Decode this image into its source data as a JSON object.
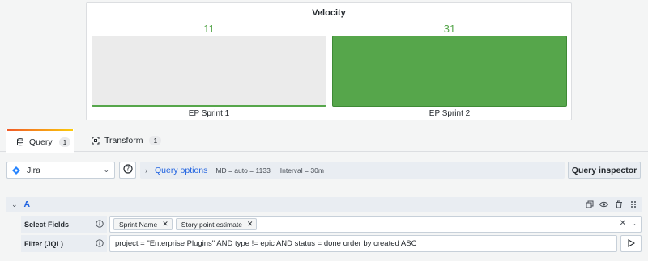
{
  "panel": {
    "title": "Velocity"
  },
  "chart_data": {
    "type": "bar",
    "title": "Velocity",
    "categories": [
      "EP Sprint 1",
      "EP Sprint 2"
    ],
    "values": [
      11,
      31
    ],
    "value_labels": [
      "11",
      "31"
    ],
    "colors": [
      "#ebebeb",
      "#56a64b"
    ],
    "value_color": "#56a64b"
  },
  "tabs": [
    {
      "label": "Query",
      "count": "1",
      "icon": "database-icon"
    },
    {
      "label": "Transform",
      "count": "1",
      "icon": "transform-icon"
    }
  ],
  "datasource": {
    "name": "Jira",
    "icon": "jira-icon"
  },
  "query_options": {
    "label": "Query options",
    "md": "MD = auto = 1133",
    "interval": "Interval = 30m"
  },
  "inspector": {
    "label": "Query inspector"
  },
  "query": {
    "name": "A",
    "select_fields_label": "Select Fields",
    "fields": [
      "Sprint Name",
      "Story point estimate"
    ],
    "filter_label": "Filter (JQL)",
    "jql": "project = \"Enterprise Plugins\" AND type != epic AND status = done order by created ASC"
  },
  "colors": {
    "accent_blue": "#1f62e0",
    "bar_green": "#56a64b",
    "bar_grey": "#ebebeb"
  }
}
